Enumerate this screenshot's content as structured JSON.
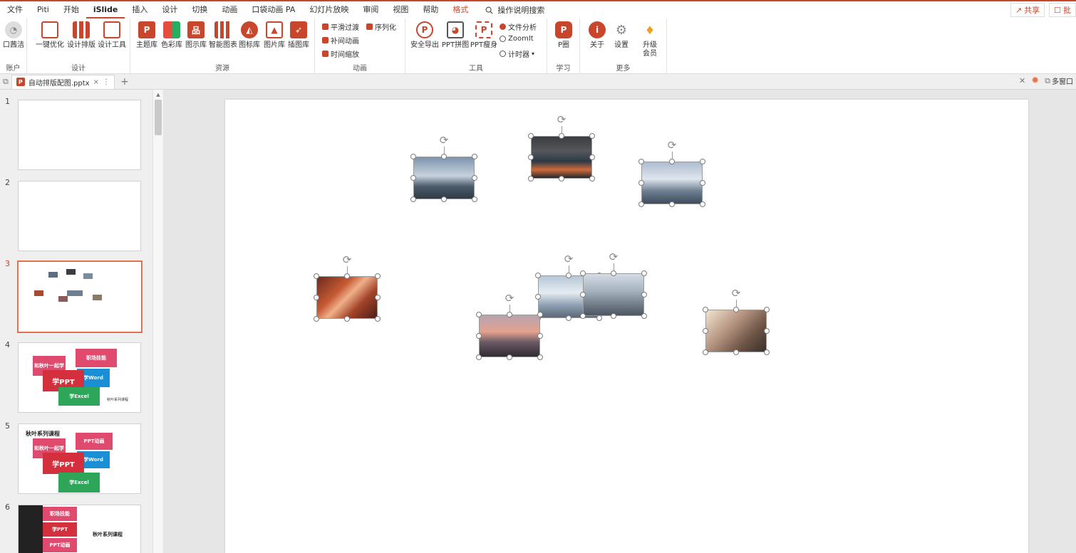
{
  "menu": {
    "items": [
      "文件",
      "Piti",
      "开始",
      "iSlide",
      "插入",
      "设计",
      "切换",
      "动画",
      "口袋动画 PA",
      "幻灯片放映",
      "审阅",
      "视图",
      "帮助",
      "格式"
    ],
    "active": "iSlide",
    "search_label": "操作说明搜索",
    "share_label": "共享",
    "right_label": "批"
  },
  "ribbon": {
    "account": {
      "btn": "口茜洁",
      "group": "账户"
    },
    "design": {
      "btns": [
        "一键优化",
        "设计排版",
        "设计工具"
      ],
      "group": "设计"
    },
    "resources": {
      "btns": [
        "主题库",
        "色彩库",
        "图示库",
        "智能图表",
        "图标库",
        "图片库",
        "插图库"
      ],
      "group": "资源"
    },
    "animation": {
      "btns": [
        "平滑过渡",
        "序列化",
        "补间动画",
        "时间缩放"
      ],
      "group": "动画"
    },
    "tools": {
      "btns": [
        "安全导出",
        "PPT拼图",
        "PPT瘦身"
      ],
      "small": [
        "文件分析",
        "ZoomIt",
        "计时器"
      ],
      "group": "工具"
    },
    "learn": {
      "btn": "P圈",
      "group": "学习"
    },
    "more": {
      "btns": [
        "关于",
        "设置",
        "升级会员"
      ],
      "group": "更多"
    }
  },
  "tab": {
    "filename": "自动排版配图.pptx",
    "right_label": "多窗口"
  },
  "thumbs": {
    "numbers": [
      "1",
      "2",
      "3",
      "4",
      "5",
      "6"
    ],
    "selected": "3",
    "card_texts": [
      "和秋叶一起学",
      "职场技能",
      "学PPT",
      "学Word",
      "学Excel",
      "PPT动画"
    ],
    "series_title": "秋叶系列课程",
    "series_small": "秋叶系列课程"
  },
  "colors": {
    "accent": "#c8462c",
    "red": "#d32f3c",
    "blue": "#1a8fd6",
    "green": "#2ea65a",
    "pink": "#e04a6e"
  }
}
